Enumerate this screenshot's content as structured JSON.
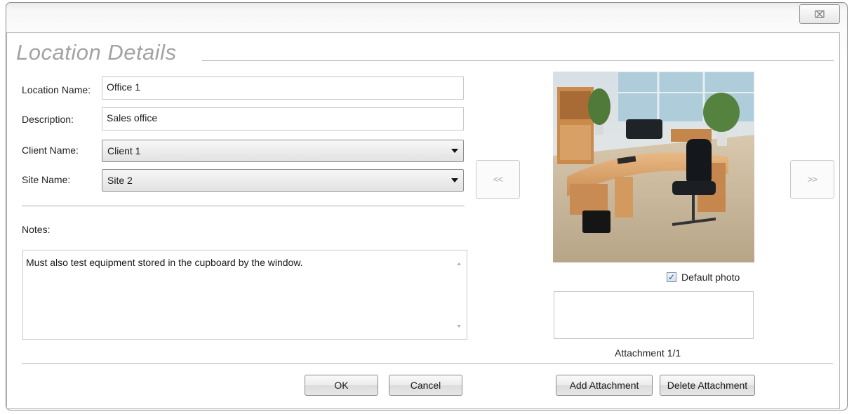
{
  "window": {
    "close_glyph": "⌧"
  },
  "form": {
    "title": "Location Details",
    "location_name_label": "Location Name:",
    "location_name_value": "Office 1",
    "description_label": "Description:",
    "description_value": "Sales office",
    "client_name_label": "Client Name:",
    "client_name_value": "Client 1",
    "site_name_label": "Site Name:",
    "site_name_value": "Site 2",
    "notes_label": "Notes:",
    "notes_value": "Must also test equipment stored in the cupboard by the window."
  },
  "gallery": {
    "prev_label": "<<",
    "next_label": ">>",
    "default_photo_label": "Default photo",
    "default_photo_checked": true,
    "check_glyph": "✓",
    "attachment_counter": "Attachment 1/1"
  },
  "buttons": {
    "ok": "OK",
    "cancel": "Cancel",
    "add_attachment": "Add Attachment",
    "delete_attachment": "Delete Attachment"
  }
}
